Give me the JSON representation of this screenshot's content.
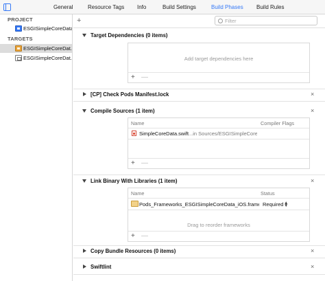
{
  "tabs": [
    "General",
    "Resource Tags",
    "Info",
    "Build Settings",
    "Build Phases",
    "Build Rules"
  ],
  "active_tab": "Build Phases",
  "colors": {
    "accent": "#3478f6",
    "selection": "#dcdcdc"
  },
  "sidebar": {
    "project_header": "PROJECT",
    "project_item": "ESGISimpleCoreData",
    "targets_header": "TARGETS",
    "target_items": [
      "ESGISimpleCoreDat...",
      "ESGISimpleCoreDat..."
    ]
  },
  "toolbar": {
    "add_icon": "plus-icon",
    "filter_placeholder": "Filter"
  },
  "phases": {
    "target_dependencies": {
      "title": "Target Dependencies (0 items)",
      "empty_message": "Add target dependencies here"
    },
    "check_pods": {
      "title": "[CP] Check Pods Manifest.lock"
    },
    "compile_sources": {
      "title": "Compile Sources (1 item)",
      "col_name": "Name",
      "col_flags": "Compiler Flags",
      "file_name": "SimpleCoreData.swift",
      "file_path": "...in Sources/ESGISimpleCore..."
    },
    "link_binary": {
      "title": "Link Binary With Libraries (1 item)",
      "col_name": "Name",
      "col_status": "Status",
      "framework_name": "Pods_Frameworks_ESGISimpleCoreData_iOS.framew",
      "status": "Required",
      "drag_hint": "Drag to reorder frameworks"
    },
    "copy_bundle": {
      "title": "Copy Bundle Resources (0 items)"
    },
    "swiftlint": {
      "title": "Swiftlint"
    }
  },
  "buttons": {
    "add": "+",
    "remove": "—",
    "close": "×"
  }
}
